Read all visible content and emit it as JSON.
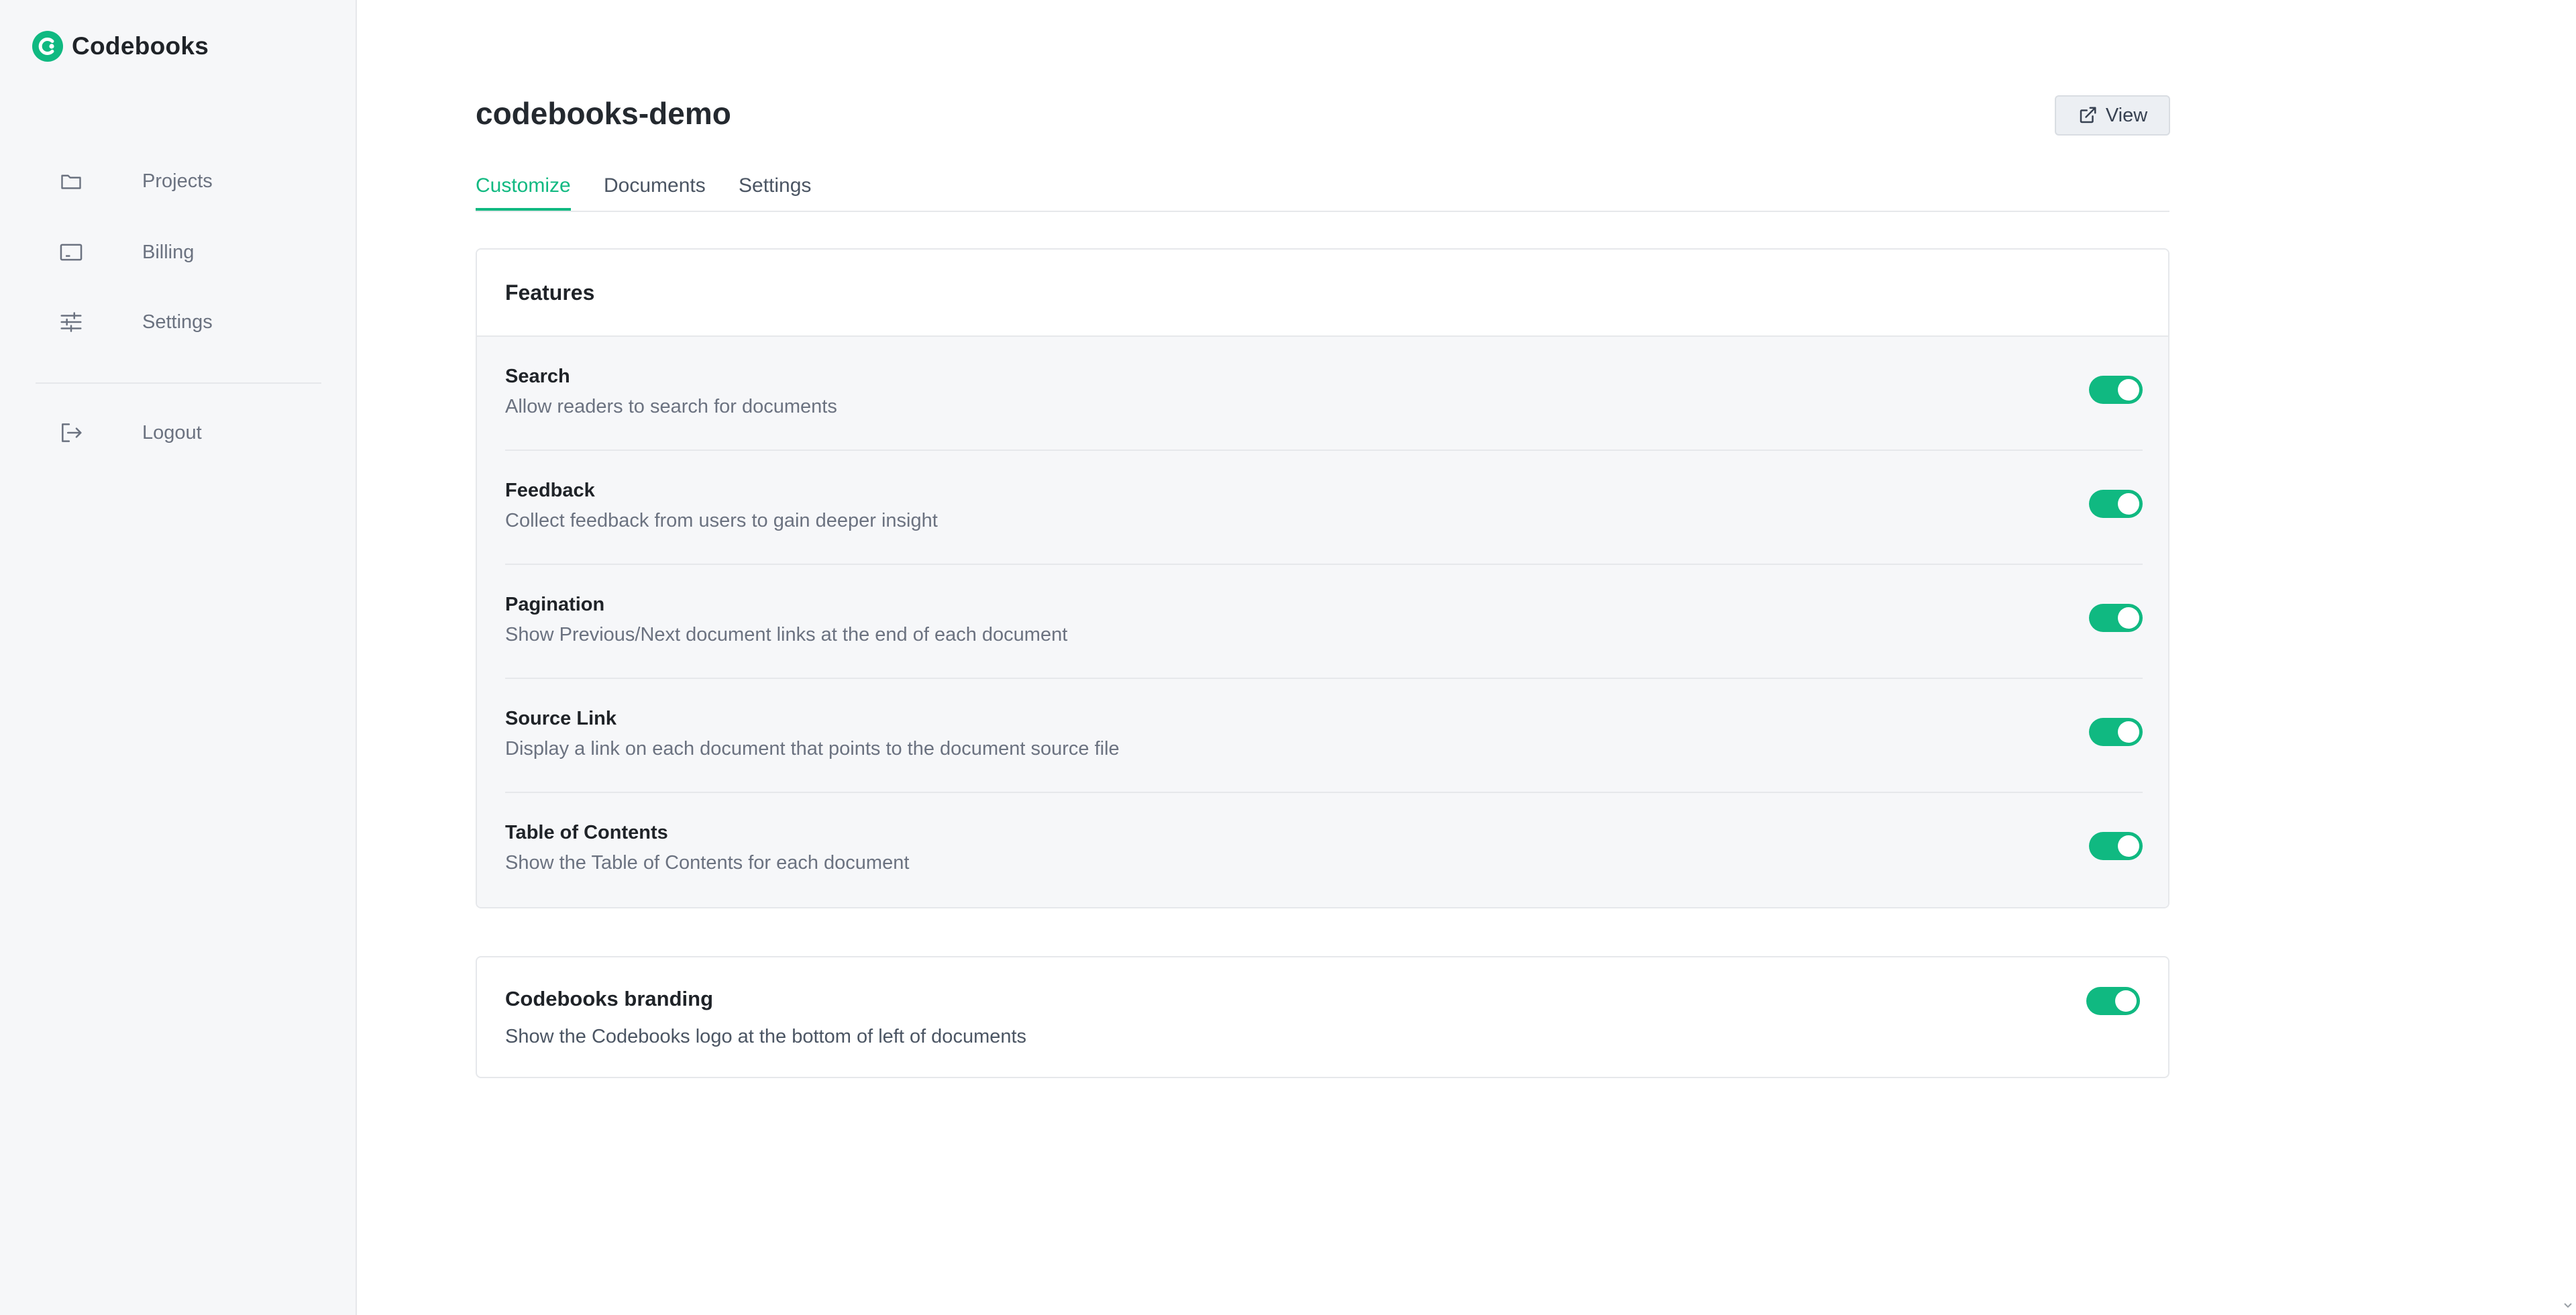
{
  "app": {
    "name": "Codebooks"
  },
  "sidebar": {
    "items": [
      {
        "label": "Projects",
        "icon": "folder-icon"
      },
      {
        "label": "Billing",
        "icon": "credit-card-icon"
      },
      {
        "label": "Settings",
        "icon": "sliders-icon"
      }
    ],
    "logout": {
      "label": "Logout",
      "icon": "logout-icon"
    }
  },
  "header": {
    "title": "codebooks-demo",
    "view_button": {
      "label": "View",
      "icon": "external-link-icon"
    }
  },
  "tabs": [
    {
      "label": "Customize",
      "active": true
    },
    {
      "label": "Documents",
      "active": false
    },
    {
      "label": "Settings",
      "active": false
    }
  ],
  "features": {
    "title": "Features",
    "items": [
      {
        "title": "Search",
        "description": "Allow readers to search for documents",
        "enabled": true
      },
      {
        "title": "Feedback",
        "description": "Collect feedback from users to gain deeper insight",
        "enabled": true
      },
      {
        "title": "Pagination",
        "description": "Show Previous/Next document links at the end of each document",
        "enabled": true
      },
      {
        "title": "Source Link",
        "description": "Display a link on each document that points to the document source file",
        "enabled": true
      },
      {
        "title": "Table of Contents",
        "description": "Show the Table of Contents for each document",
        "enabled": true
      }
    ]
  },
  "branding": {
    "title": "Codebooks branding",
    "description": "Show the Codebooks logo at the bottom of left of documents",
    "enabled": true
  },
  "colors": {
    "accent": "#10b981",
    "sidebar_bg": "#f6f7f9",
    "border": "#e6e8eb"
  }
}
